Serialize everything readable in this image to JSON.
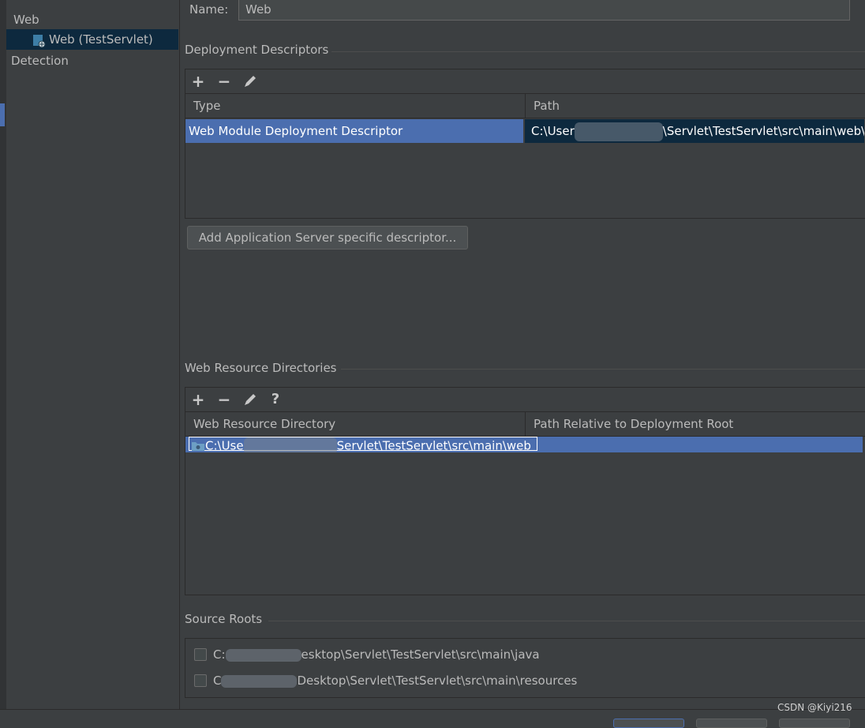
{
  "sidebar": {
    "items": [
      {
        "label": "Web"
      },
      {
        "label": "Web (TestServlet)"
      },
      {
        "label": "Detection"
      }
    ]
  },
  "name_field": {
    "label": "Name:",
    "value": "Web"
  },
  "deployment_descriptors": {
    "title": "Deployment Descriptors",
    "columns": [
      "Type",
      "Path"
    ],
    "rows": [
      {
        "type": "Web Module Deployment Descriptor",
        "path_prefix": "C:\\User",
        "path_suffix": "\\Servlet\\TestServlet\\src\\main\\web\\"
      }
    ],
    "add_button": "Add Application Server specific descriptor..."
  },
  "web_resources": {
    "title": "Web Resource Directories",
    "columns": [
      "Web Resource Directory",
      "Path Relative to Deployment Root"
    ],
    "rows": [
      {
        "dir_prefix": "C:\\Use",
        "dir_suffix": "Servlet\\TestServlet\\src\\main\\web",
        "relative": ""
      }
    ]
  },
  "source_roots": {
    "title": "Source Roots",
    "items": [
      {
        "prefix": "C:",
        "suffix": "esktop\\Servlet\\TestServlet\\src\\main\\java",
        "checked": false
      },
      {
        "prefix": "C",
        "suffix": "Desktop\\Servlet\\TestServlet\\src\\main\\resources",
        "checked": false
      }
    ]
  },
  "watermark": "CSDN @Kiyi216",
  "colors": {
    "selection": "#4b6eaf",
    "background": "#3c3f41",
    "accent_dark": "#0d293e"
  }
}
